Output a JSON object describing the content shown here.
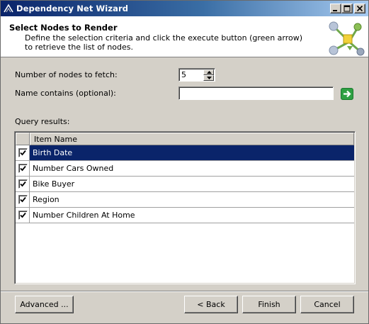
{
  "window": {
    "title": "Dependency Net Wizard",
    "controls": [
      "minimize-icon",
      "maximize-icon",
      "close-icon"
    ]
  },
  "header": {
    "title": "Select Nodes to Render",
    "description": "Define the selection criteria and click the execute button (green arrow) to retrieve the list of nodes."
  },
  "form": {
    "nodes_label": "Number of nodes to fetch:",
    "nodes_value": "5",
    "name_label": "Name contains (optional):",
    "name_value": "",
    "execute_icon": "green-arrow-icon"
  },
  "results": {
    "label": "Query results:",
    "column_header": "Item Name",
    "rows": [
      {
        "name": "Birth Date",
        "checked": true,
        "selected": true
      },
      {
        "name": "Number Cars Owned",
        "checked": true,
        "selected": false
      },
      {
        "name": "Bike Buyer",
        "checked": true,
        "selected": false
      },
      {
        "name": "Region",
        "checked": true,
        "selected": false
      },
      {
        "name": "Number Children At Home",
        "checked": true,
        "selected": false
      }
    ]
  },
  "buttons": {
    "advanced": "Advanced ...",
    "back": "< Back",
    "finish": "Finish",
    "cancel": "Cancel"
  },
  "colors": {
    "selection": "#0a246a",
    "title_gradient_start": "#0a246a",
    "title_gradient_end": "#a6caf0",
    "execute_green": "#2ea043"
  }
}
